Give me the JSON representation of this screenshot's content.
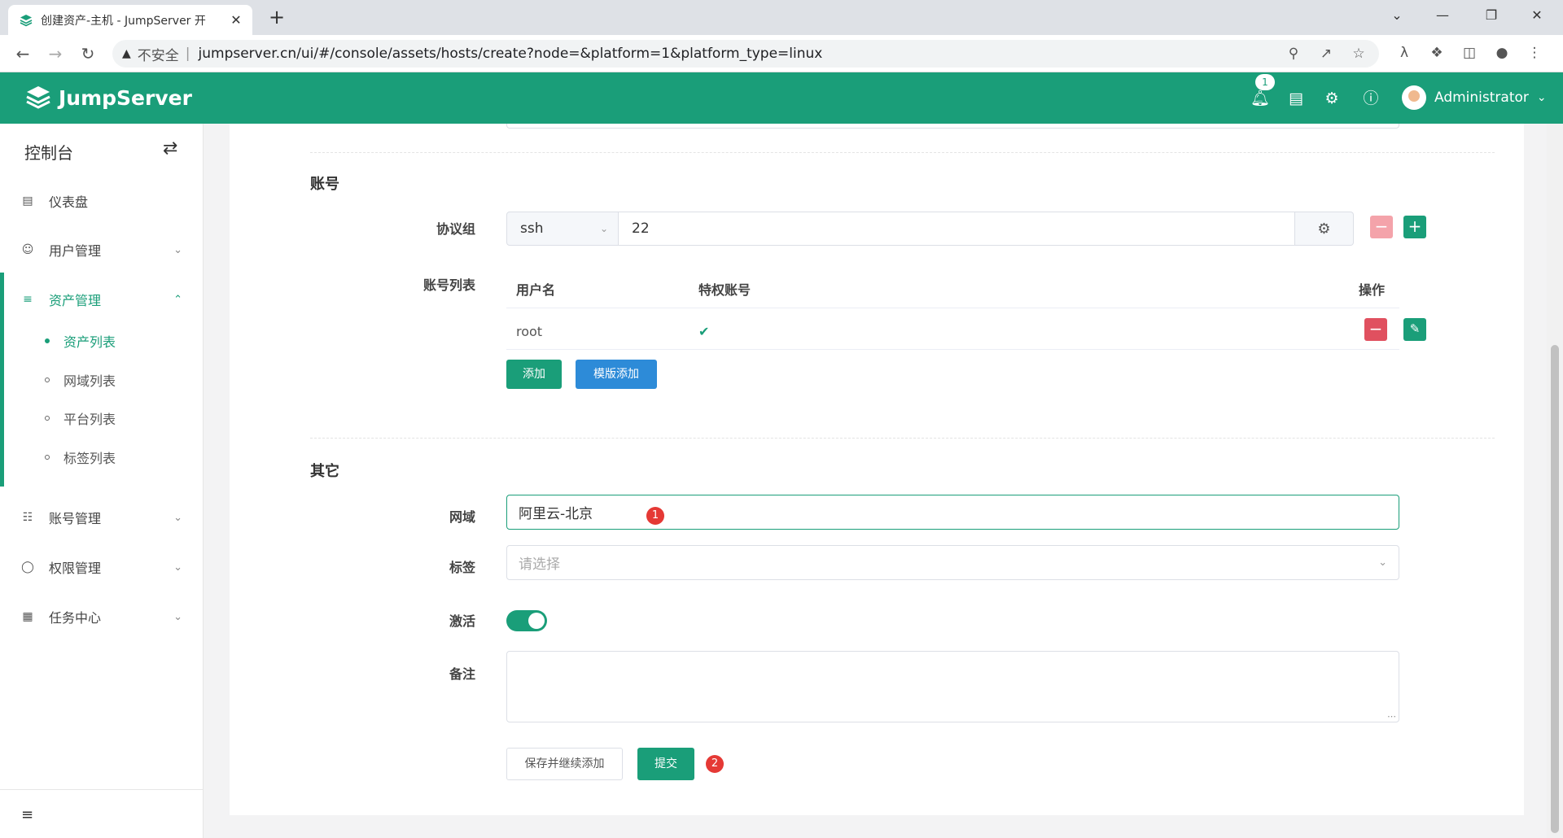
{
  "browser": {
    "tab_title": "创建资产-主机 - JumpServer 开",
    "tab_close": "✕",
    "new_tab": "+",
    "window_controls": [
      "⌄",
      "—",
      "❐",
      "✕"
    ],
    "insecure_label": "不安全",
    "separator": "|",
    "url": "jumpserver.cn/ui/#/console/assets/hosts/create?node=&platform=1&platform_type=linux",
    "icons": [
      "back-icon",
      "forward-icon",
      "reload-icon",
      "key-icon",
      "share-icon",
      "star-icon",
      "extension-icon",
      "puzzle-icon",
      "sidepanel-icon",
      "profile-icon",
      "more-icon"
    ]
  },
  "header": {
    "brand": "JumpServer",
    "notification_count": "1",
    "user_name": "Administrator",
    "accent_color": "#1a9e79"
  },
  "sidebar": {
    "title": "控制台",
    "items": [
      {
        "label": "仪表盘",
        "icon": "dashboard-icon"
      },
      {
        "label": "用户管理",
        "icon": "users-icon"
      },
      {
        "label": "资产管理",
        "icon": "layers-icon"
      },
      {
        "label": "账号管理",
        "icon": "account-icon"
      },
      {
        "label": "权限管理",
        "icon": "shield-icon"
      },
      {
        "label": "任务中心",
        "icon": "calendar-icon"
      }
    ],
    "subitems": [
      "资产列表",
      "网域列表",
      "平台列表",
      "标签列表"
    ]
  },
  "form": {
    "account_section": "账号",
    "protocol_label": "协议组",
    "protocol_name": "ssh",
    "protocol_port": "22",
    "account_list_label": "账号列表",
    "table": {
      "headers": [
        "用户名",
        "特权账号",
        "操作"
      ],
      "rows": [
        {
          "username": "root",
          "privileged": "✔"
        }
      ]
    },
    "add_button": "添加",
    "template_add_button": "模版添加",
    "other_section": "其它",
    "domain_label": "网域",
    "domain_value": "阿里云-北京",
    "labels_label": "标签",
    "labels_placeholder": "请选择",
    "active_label": "激活",
    "active": true,
    "comment_label": "备注",
    "save_continue_button": "保存并继续添加",
    "submit_button": "提交",
    "markers": [
      "1",
      "2"
    ]
  }
}
